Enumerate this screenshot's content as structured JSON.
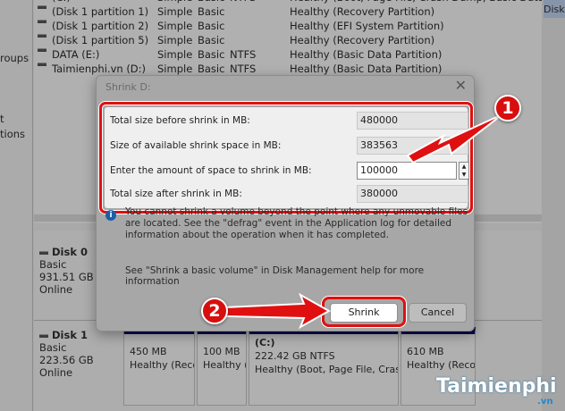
{
  "left_pane": {
    "items": [
      "roups",
      "t",
      "tions"
    ]
  },
  "volumes": [
    {
      "name": "(C:)",
      "layout": "Simple",
      "type": "Basic",
      "fs": "NTFS",
      "status": "Healthy (Boot, Page File, Crash Dump, Basic Data Partit"
    },
    {
      "name": "(Disk 1 partition 1)",
      "layout": "Simple",
      "type": "Basic",
      "fs": "",
      "status": "Healthy (Recovery Partition)"
    },
    {
      "name": "(Disk 1 partition 2)",
      "layout": "Simple",
      "type": "Basic",
      "fs": "",
      "status": "Healthy (EFI System Partition)"
    },
    {
      "name": "(Disk 1 partition 5)",
      "layout": "Simple",
      "type": "Basic",
      "fs": "",
      "status": "Healthy (Recovery Partition)"
    },
    {
      "name": "DATA (E:)",
      "layout": "Simple",
      "type": "Basic",
      "fs": "NTFS",
      "status": "Healthy (Basic Data Partition)"
    },
    {
      "name": "Taimienphi.vn (D:)",
      "layout": "Simple",
      "type": "Basic",
      "fs": "NTFS",
      "status": "Healthy (Basic Data Partition)"
    }
  ],
  "right_strip": "Disk",
  "disks": [
    {
      "name": "Disk 0",
      "type": "Basic",
      "size": "931.51 GB",
      "state": "Online"
    },
    {
      "name": "Disk 1",
      "type": "Basic",
      "size": "223.56 GB",
      "state": "Online"
    }
  ],
  "disk1_partitions": [
    {
      "label": "",
      "size": "450 MB",
      "status": "Healthy (Reco"
    },
    {
      "label": "",
      "size": "100 MB",
      "status": "Healthy (I"
    },
    {
      "label": "(C:)",
      "size": "222.42 GB NTFS",
      "status": "Healthy (Boot, Page File, Crash"
    },
    {
      "label": "",
      "size": "610 MB",
      "status": "Healthy (Recov"
    }
  ],
  "dialog": {
    "title": "Shrink D:",
    "close": "✕",
    "fields": [
      {
        "label": "Total size before shrink in MB:",
        "value": "480000"
      },
      {
        "label": "Size of available shrink space in MB:",
        "value": "383563"
      },
      {
        "label": "Enter the amount of space to shrink in MB:",
        "value": "100000"
      },
      {
        "label": "Total size after shrink in MB:",
        "value": "380000"
      }
    ],
    "info_icon": "i",
    "message": "You cannot shrink a volume beyond the point where any unmovable files are located. See the \"defrag\" event in the Application log for detailed information about the operation when it has completed.",
    "help": "See \"Shrink a basic volume\" in Disk Management help for more information",
    "shrink_label": "Shrink",
    "cancel_label": "Cancel"
  },
  "annotations": {
    "step1": "1",
    "step2": "2",
    "accent": "#e01010"
  },
  "watermark": {
    "brand": "Taimienphi",
    "tld": ".vn"
  }
}
